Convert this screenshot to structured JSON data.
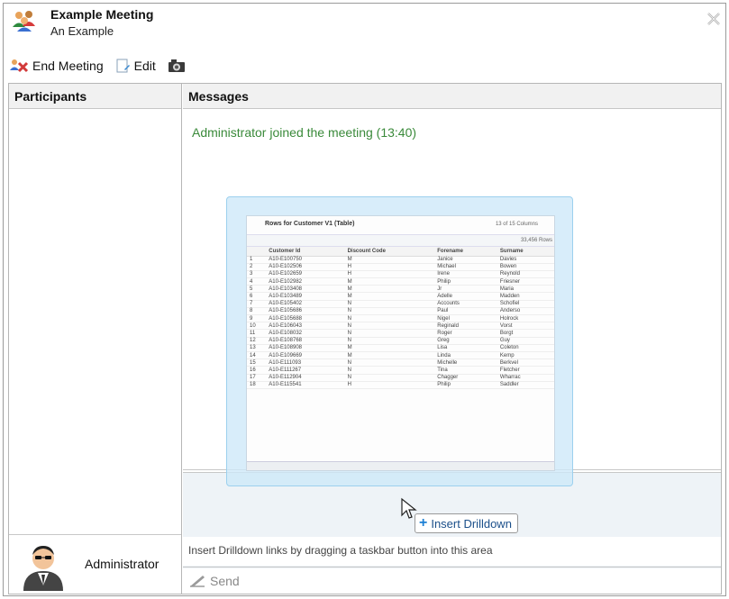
{
  "meeting": {
    "title": "Example Meeting",
    "subtitle": "An Example"
  },
  "toolbar": {
    "end_label": "End Meeting",
    "edit_label": "Edit"
  },
  "participants": {
    "header": "Participants",
    "name": "Administrator"
  },
  "messages": {
    "header": "Messages",
    "log": "Administrator joined the meeting (13:40)",
    "hint": "Insert Drilldown links by dragging a taskbar button into this area",
    "send_label": "Send"
  },
  "drag_tooltip": {
    "label": "Insert Drilldown"
  },
  "ghost_preview": {
    "title": "Rows for Customer V1 (Table)",
    "columns_info": "13 of 15 Columns",
    "rows_info": "33,456 Rows",
    "headers": [
      "",
      "Customer Id",
      "Discount Code",
      "Forename",
      "Surname"
    ],
    "rows": [
      [
        "1",
        "A10-E100750",
        "M",
        "Janice",
        "Davies"
      ],
      [
        "2",
        "A10-E102506",
        "H",
        "Michael",
        "Bowen"
      ],
      [
        "3",
        "A10-E102659",
        "H",
        "Irene",
        "Reynold"
      ],
      [
        "4",
        "A10-E102982",
        "M",
        "Philip",
        "Friesner"
      ],
      [
        "5",
        "A10-E103408",
        "M",
        "Jr",
        "Maria"
      ],
      [
        "6",
        "A10-E103489",
        "M",
        "Adelle",
        "Madden"
      ],
      [
        "7",
        "A10-E105402",
        "N",
        "Accounts",
        "Schofiel"
      ],
      [
        "8",
        "A10-E105686",
        "N",
        "Paul",
        "Anderso"
      ],
      [
        "9",
        "A10-E105688",
        "N",
        "Nigel",
        "Holrock"
      ],
      [
        "10",
        "A10-E106043",
        "N",
        "Reginald",
        "Vorst"
      ],
      [
        "11",
        "A10-E108032",
        "N",
        "Roger",
        "Borgt"
      ],
      [
        "12",
        "A10-E108768",
        "N",
        "Greg",
        "Guy"
      ],
      [
        "13",
        "A10-E108908",
        "M",
        "Lisa",
        "Coleton"
      ],
      [
        "14",
        "A10-E109669",
        "M",
        "Linda",
        "Kemp"
      ],
      [
        "15",
        "A10-E111093",
        "N",
        "Michelle",
        "Berkvel"
      ],
      [
        "16",
        "A10-E111267",
        "N",
        "Tina",
        "Fletcher"
      ],
      [
        "17",
        "A10-E112904",
        "N",
        "Chagger",
        "Wharrac"
      ],
      [
        "18",
        "A10-E115541",
        "H",
        "Philip",
        "Saddler"
      ]
    ]
  },
  "colors": {
    "log_text": "#3a8a3a",
    "drop_area": "#eef3f7",
    "ghost_bg": "#cde8f8"
  },
  "icons": [
    "people-icon",
    "close-icon",
    "end-meeting-icon",
    "edit-icon",
    "camera-icon",
    "avatar",
    "send-icon",
    "cursor-arrow-icon",
    "plus-icon"
  ]
}
